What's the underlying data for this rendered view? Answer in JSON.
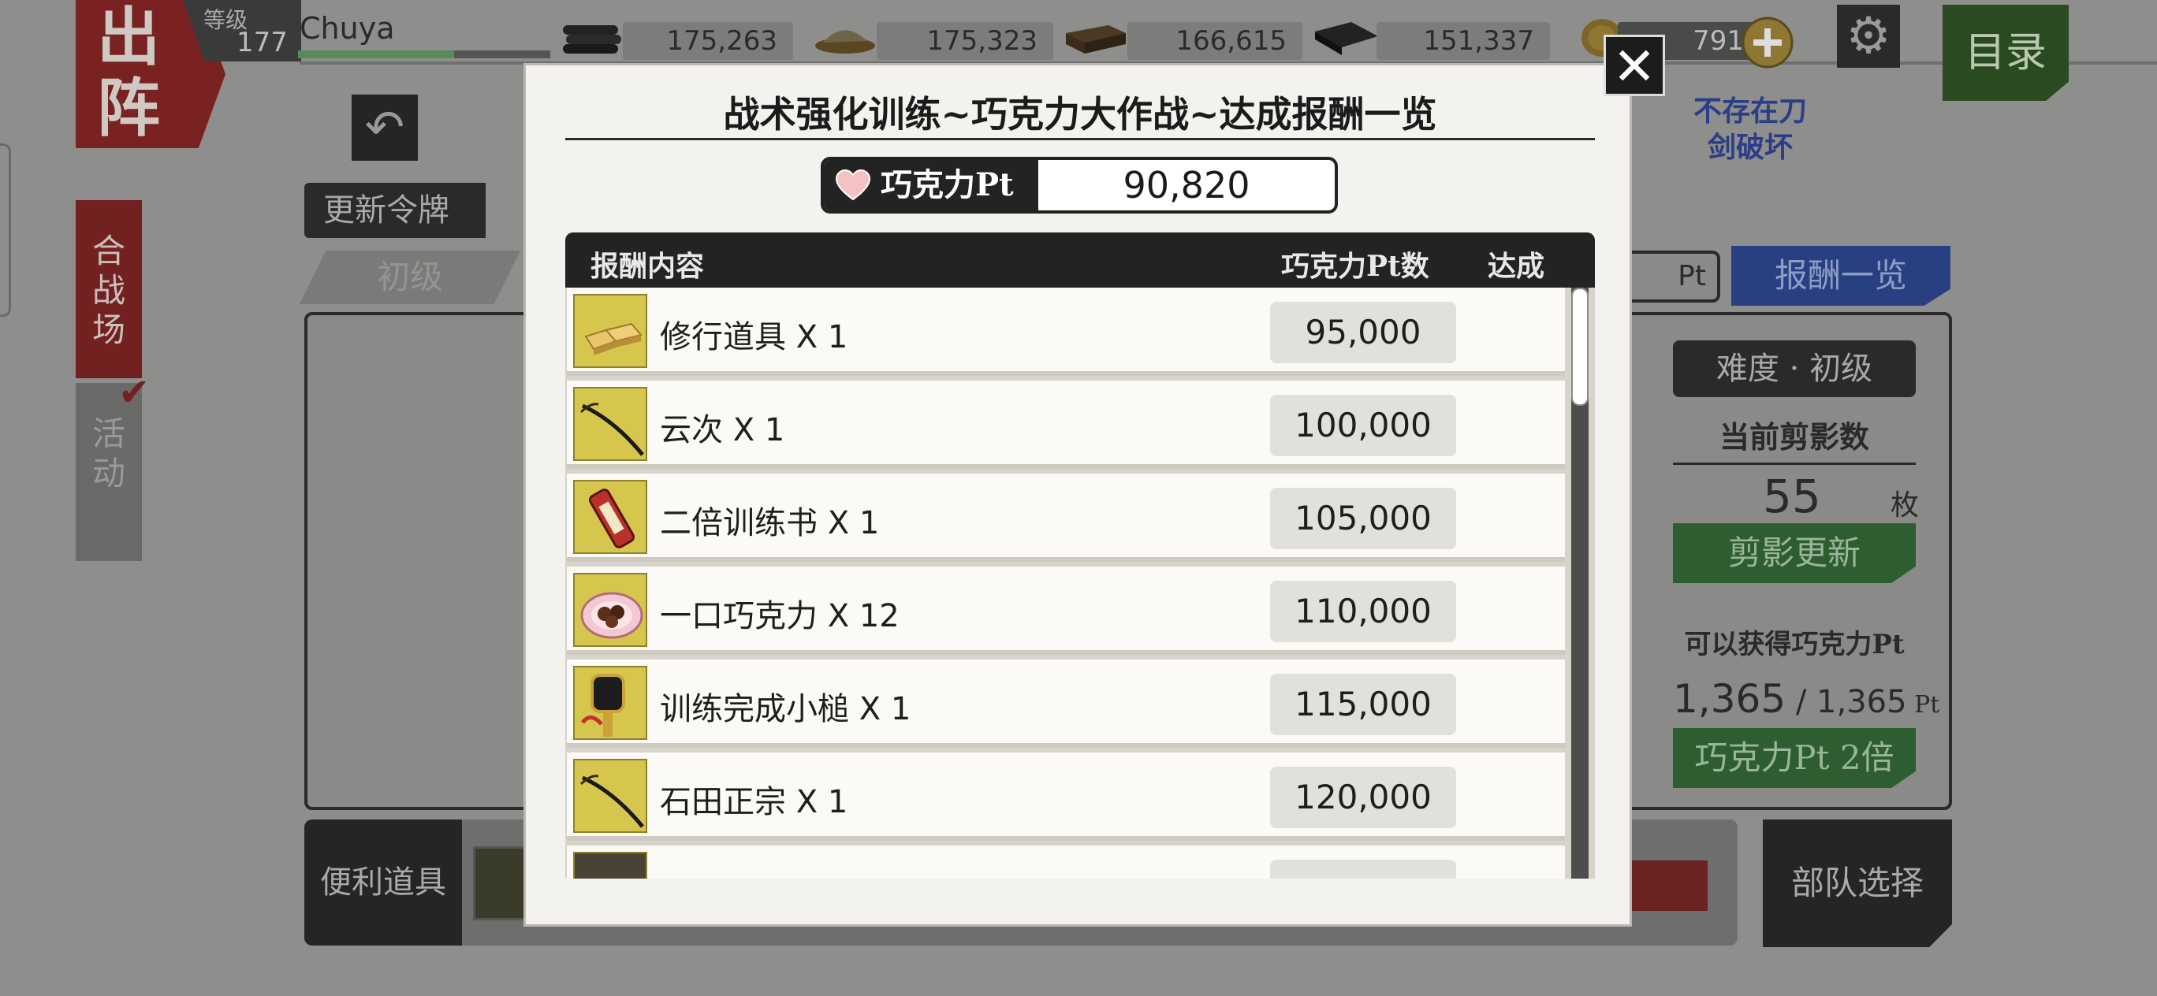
{
  "player": {
    "level_label": "等级",
    "level": "177",
    "name": "Chuya",
    "exp_fraction": 0.62
  },
  "resources": [
    {
      "icon": "charcoal-icon",
      "value": "175,263"
    },
    {
      "icon": "steel-icon",
      "value": "175,323"
    },
    {
      "icon": "cooling-material-icon",
      "value": "166,615"
    },
    {
      "icon": "whetstone-icon",
      "value": "151,337"
    },
    {
      "icon": "koban-coin-icon",
      "value": "791"
    }
  ],
  "header": {
    "sortie_label": "出阵",
    "menu_label": "目录",
    "settings_icon": "gear-icon"
  },
  "left_tabs": {
    "battlefield": "合战场",
    "event": "活动"
  },
  "background": {
    "update_token": "更新令牌",
    "beginner_tab": "初级",
    "no_break_badge": "不存在刀剑破坏",
    "pt_suffix": "Pt",
    "reward_list_button": "报酬一览",
    "difficulty": "难度 · 初级",
    "current_silhouettes_label": "当前剪影数",
    "silhouette_count": "55",
    "count_unit": "枚",
    "update_silhouettes_button": "剪影更新",
    "obtainable_label": "可以获得巧克力Pt",
    "obtainable_current": "1,365",
    "obtainable_max": "1,365",
    "double_button": "巧克力Pt 2倍",
    "useful_items": "便利道具",
    "squad_select": "部队选择"
  },
  "modal": {
    "title": "战术强化训练~巧克力大作战~达成报酬一览",
    "close_symbol": "✕",
    "pt_label": "巧克力Pt",
    "pt_value": "90,820",
    "columns": {
      "content": "报酬内容",
      "pt": "巧克力Pt数",
      "achieved": "达成"
    },
    "rewards": [
      {
        "name": "修行道具 X 1",
        "pt": "95,000",
        "icon": "training-tools-icon"
      },
      {
        "name": "云次 X 1",
        "pt": "100,000",
        "icon": "sword-icon"
      },
      {
        "name": "二倍训练书 X 1",
        "pt": "105,000",
        "icon": "scroll-icon"
      },
      {
        "name": "一口巧克力 X 12",
        "pt": "110,000",
        "icon": "chocolate-plate-icon"
      },
      {
        "name": "训练完成小槌 X 1",
        "pt": "115,000",
        "icon": "mallet-icon"
      },
      {
        "name": "石田正宗 X 1",
        "pt": "120,000",
        "icon": "sword-icon"
      }
    ]
  }
}
